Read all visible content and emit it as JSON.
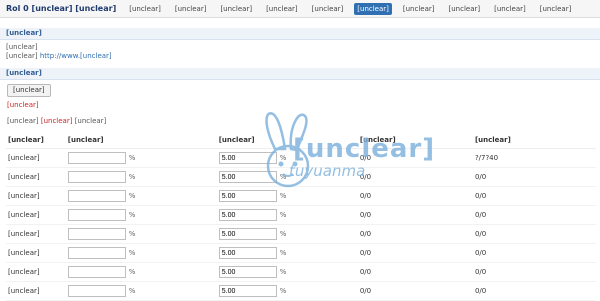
{
  "topnav": {
    "brand": "Rol 0 [unclear] [unclear]",
    "items": [
      "[unclear]",
      "[unclear]",
      "[unclear]",
      "[unclear]",
      "[unclear]",
      "[unclear]",
      "[unclear]",
      "[unclear]",
      "[unclear]",
      "[unclear]"
    ],
    "active_index": 5
  },
  "panel1": {
    "title": "[unclear]",
    "line1": "[unclear]",
    "line2_prefix": "[unclear]",
    "url": "http://www.[unclear]"
  },
  "panel2": {
    "title": "[unclear]",
    "button": "[unclear]",
    "warning": "[unclear]",
    "meta_prefix": "[unclear]",
    "meta_hl": "[unclear]",
    "meta_suffix": "[unclear]"
  },
  "table": {
    "headers": [
      "[unclear]",
      "[unclear]",
      "[unclear]",
      "[unclear]",
      "[unclear]"
    ],
    "rows": [
      {
        "user": "[unclear]",
        "a": "",
        "b": "5.00",
        "c": "0/0",
        "d": "?/7?40"
      },
      {
        "user": "[unclear]",
        "a": "",
        "b": "5.00",
        "c": "0/0",
        "d": "0/0"
      },
      {
        "user": "[unclear]",
        "a": "",
        "b": "5.00",
        "c": "0/0",
        "d": "0/0"
      },
      {
        "user": "[unclear]",
        "a": "",
        "b": "5.00",
        "c": "0/0",
        "d": "0/0"
      },
      {
        "user": "[unclear]",
        "a": "",
        "b": "5.00",
        "c": "0/0",
        "d": "0/0"
      },
      {
        "user": "[unclear]",
        "a": "",
        "b": "5.00",
        "c": "0/0",
        "d": "0/0"
      },
      {
        "user": "[unclear]",
        "a": "",
        "b": "5.00",
        "c": "0/0",
        "d": "0/0"
      },
      {
        "user": "[unclear]",
        "a": "",
        "b": "5.00",
        "c": "0/0",
        "d": "0/0"
      }
    ],
    "percent_symbol": "%"
  },
  "watermark": {
    "text_cn": "[unclear]",
    "text_en": "tuyuanma"
  }
}
